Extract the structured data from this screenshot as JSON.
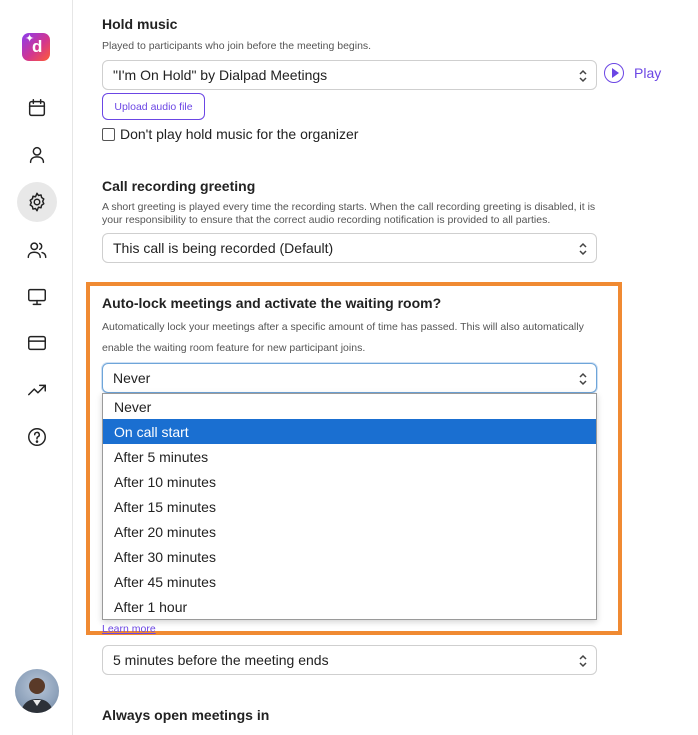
{
  "brand": {
    "logo_letter": "d"
  },
  "sidebar": {
    "items": [
      {
        "name": "calendar",
        "active": false
      },
      {
        "name": "person",
        "active": false
      },
      {
        "name": "settings",
        "active": true
      },
      {
        "name": "people",
        "active": false
      },
      {
        "name": "monitor",
        "active": false
      },
      {
        "name": "billing",
        "active": false
      },
      {
        "name": "analytics",
        "active": false
      },
      {
        "name": "help",
        "active": false
      }
    ]
  },
  "hold_music": {
    "title": "Hold music",
    "description": "Played to participants who join before the meeting begins.",
    "select_value": "\"I'm On Hold\" by Dialpad Meetings",
    "play_label": "Play",
    "upload_label": "Upload audio file",
    "checkbox_label": "Don't play hold music for the organizer",
    "checkbox_checked": false
  },
  "call_recording": {
    "title": "Call recording greeting",
    "description": "A short greeting is played every time the recording starts. When the call recording greeting is disabled, it is your responsibility to ensure that the correct audio recording notification is provided to all parties.",
    "select_value": "This call is being recorded (Default)"
  },
  "auto_lock": {
    "title": "Auto-lock meetings and activate the waiting room?",
    "description_line1": "Automatically lock your meetings after a specific amount of time has passed. This will also automatically",
    "description_line2": "enable the waiting room feature for new participant joins.",
    "select_value": "Never",
    "options": [
      "Never",
      "On call start",
      "After 5 minutes",
      "After 10 minutes",
      "After 15 minutes",
      "After 20 minutes",
      "After 30 minutes",
      "After 45 minutes",
      "After 1 hour"
    ],
    "highlighted_option": "On call start"
  },
  "learn_more": "Learn more",
  "end_reminder": {
    "select_value": "5 minutes before the meeting ends"
  },
  "open_meetings": {
    "title": "Always open meetings in"
  },
  "colors": {
    "accent": "#6b46e4",
    "highlight_border": "#f08a32",
    "option_selected": "#1a6fd1"
  }
}
